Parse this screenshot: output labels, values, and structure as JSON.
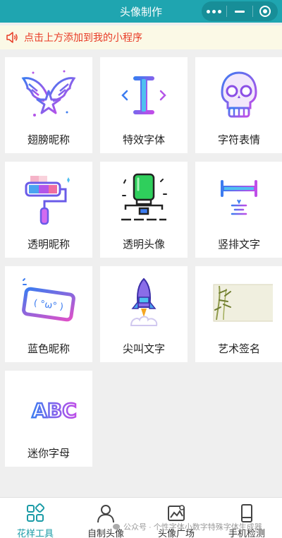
{
  "window": {
    "title": "头像制作"
  },
  "notice": {
    "text": "点击上方添加到我的小程序",
    "color": "#e83a25"
  },
  "grid": {
    "items": [
      {
        "label": "翅膀昵称",
        "icon": "wing-star-icon"
      },
      {
        "label": "特效字体",
        "icon": "text-cursor-icon"
      },
      {
        "label": "字符表情",
        "icon": "skull-emoji-icon"
      },
      {
        "label": "透明昵称",
        "icon": "paint-roller-icon"
      },
      {
        "label": "透明头像",
        "icon": "slime-block-icon"
      },
      {
        "label": "竖排文字",
        "icon": "vertical-text-icon"
      },
      {
        "label": "蓝色昵称",
        "icon": "kaomoji-tag-icon"
      },
      {
        "label": "尖叫文字",
        "icon": "rocket-icon"
      },
      {
        "label": "艺术签名",
        "icon": "bamboo-painting-icon"
      },
      {
        "label": "迷你字母",
        "icon": "abc-letters-icon"
      }
    ]
  },
  "tabbar": {
    "tabs": [
      {
        "label": "花样工具",
        "icon": "grid-tools-icon",
        "active": true
      },
      {
        "label": "自制头像",
        "icon": "person-icon",
        "active": false
      },
      {
        "label": "头像广场",
        "icon": "image-gallery-icon",
        "active": false
      },
      {
        "label": "手机检测",
        "icon": "phone-icon",
        "active": false
      }
    ]
  },
  "watermark": {
    "text": "公众号 · 个性字体小数字特殊字体生成器"
  },
  "colors": {
    "titlebar": "#1fa5b0",
    "active_tab": "#1a9ba6",
    "icon_blue": "#3c7cf0",
    "icon_purple": "#b455e8"
  }
}
